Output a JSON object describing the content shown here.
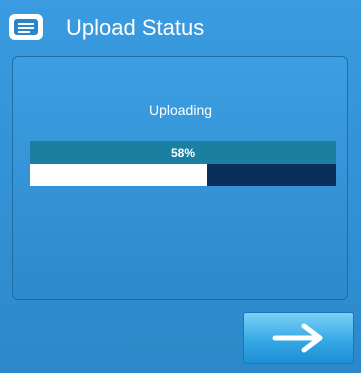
{
  "header": {
    "title": "Upload Status",
    "icon": "menu-list-icon"
  },
  "status": {
    "label": "Uploading",
    "percent_text": "58%",
    "progress_percent": 58
  },
  "next_button": {
    "icon": "arrow-right-icon"
  },
  "colors": {
    "background": "#2f8fd0",
    "percent_bar": "#1a7fa0",
    "progress_track": "#0b2e5a",
    "progress_fill": "#ffffff"
  }
}
